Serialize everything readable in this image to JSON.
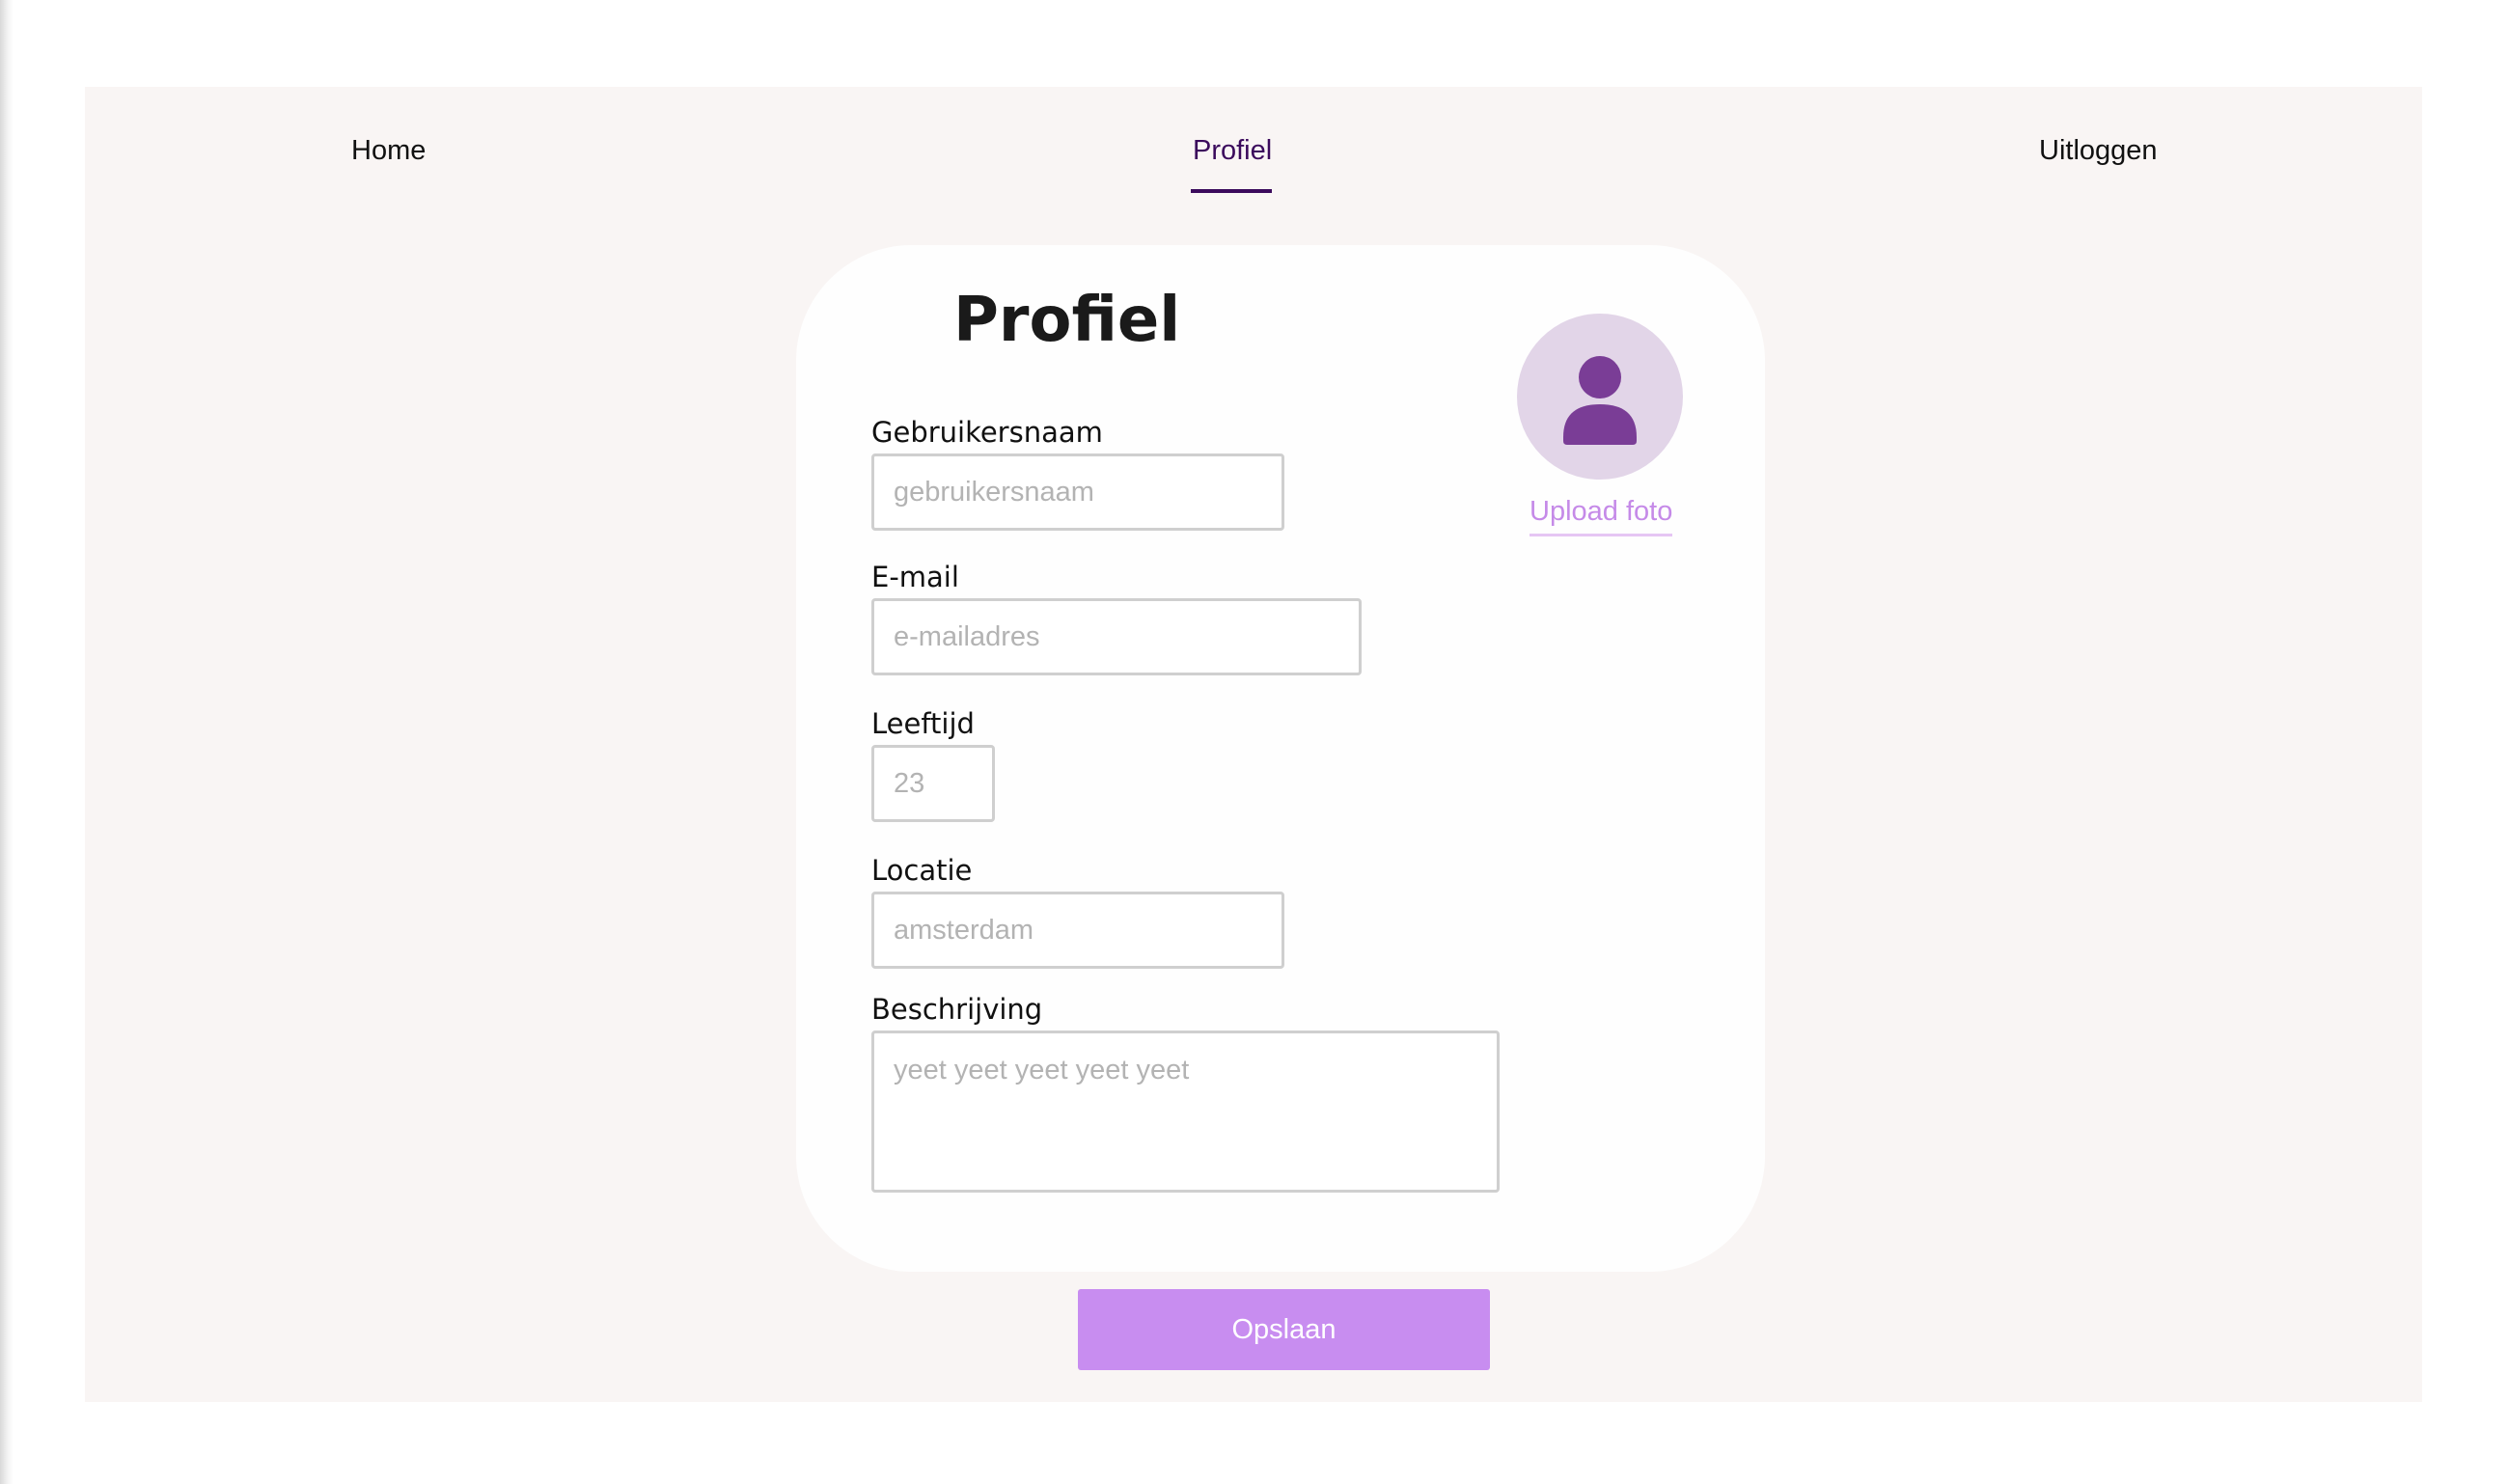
{
  "nav": {
    "home": "Home",
    "profile": "Profiel",
    "logout": "Uitloggen"
  },
  "profile": {
    "title": "Profiel",
    "upload_label": "Upload foto",
    "fields": {
      "username": {
        "label": "Gebruikersnaam",
        "placeholder": "gebruikersnaam"
      },
      "email": {
        "label": "E-mail",
        "placeholder": "e-mailadres"
      },
      "age": {
        "label": "Leeftijd",
        "placeholder": "23"
      },
      "location": {
        "label": "Locatie",
        "placeholder": "amsterdam"
      },
      "description": {
        "label": "Beschrijving",
        "placeholder": "yeet yeet yeet yeet yeet"
      }
    },
    "save_label": "Opslaan"
  },
  "colors": {
    "background": "#f9f5f4",
    "card": "#fefefe",
    "nav_active": "#3b0a5c",
    "accent": "#c88df0",
    "avatar_bg": "#e2d5e8",
    "avatar_icon": "#7a3d96",
    "upload_link": "#c58ae8"
  },
  "icons": {
    "avatar": "user-icon"
  }
}
